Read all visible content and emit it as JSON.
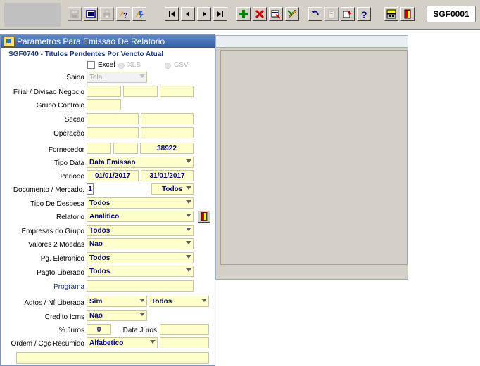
{
  "toolbar": {
    "screen_id": "SGF0001",
    "buttons": [
      {
        "name": "save-icon",
        "disabled": true
      },
      {
        "name": "clear-icon",
        "disabled": false
      },
      {
        "name": "print-icon",
        "disabled": true
      },
      {
        "name": "query-help-icon",
        "disabled": false
      },
      {
        "name": "execute-query-icon",
        "disabled": false
      },
      {
        "name": "first-record-icon",
        "disabled": false
      },
      {
        "name": "prev-record-icon",
        "disabled": false
      },
      {
        "name": "next-record-icon",
        "disabled": false
      },
      {
        "name": "last-record-icon",
        "disabled": false
      },
      {
        "name": "insert-record-icon",
        "disabled": false
      },
      {
        "name": "delete-record-icon",
        "disabled": false
      },
      {
        "name": "duplicate-record-icon",
        "disabled": false
      },
      {
        "name": "edit-icon",
        "disabled": false
      },
      {
        "name": "undo-icon",
        "disabled": false
      },
      {
        "name": "copy-icon",
        "disabled": true
      },
      {
        "name": "list-values-icon",
        "disabled": false
      },
      {
        "name": "help-icon",
        "disabled": false
      },
      {
        "name": "news-icon",
        "disabled": false
      },
      {
        "name": "exit-icon",
        "disabled": false
      }
    ]
  },
  "dialog": {
    "title": "Parametros Para Emissao De Relatorio",
    "subtitle": "SGF0740 - Titulos Pendentes Por Vencto Atual",
    "options": {
      "excel": "Excel",
      "xls": "XLS",
      "csv": "CSV"
    },
    "labels": {
      "saida": "Saida",
      "filial": "Filial / Divisao Negocio",
      "grupo": "Grupo Controle",
      "secao": "Secao",
      "operacao": "Operação",
      "fornecedor": "Fornecedor",
      "tipo_data": "Tipo Data",
      "periodo": "Periodo",
      "documento": "Documento / Mercado.",
      "tipo_despesa": "Tipo De Despesa",
      "relatorio": "Relatorio",
      "empresas": "Empresas do Grupo",
      "valores": "Valores 2 Moedas",
      "pg_eletronico": "Pg. Eletronico",
      "pagto": "Pagto Liberado",
      "programa": "Programa",
      "adtos": "Adtos / Nf Liberada",
      "credito": "Credito Icms",
      "juros": "% Juros",
      "data_juros": "Data Juros",
      "ordem": "Ordem / Cgc Resumido"
    },
    "values": {
      "saida": "Tela",
      "fornecedor": "38922",
      "tipo_data": "Data Emissao",
      "periodo_inicio": "01/01/2017",
      "periodo_fim": "31/01/2017",
      "documento": "1",
      "mercado": "Todos",
      "tipo_despesa": "Todos",
      "relatorio": "Analitico",
      "empresas": "Todos",
      "valores": "Nao",
      "pg_eletronico": "Todos",
      "pagto": "Todos",
      "adtos": "Sim",
      "nf_liberada": "Todos",
      "credito": "Nao",
      "juros": "0",
      "ordem": "Alfabetico"
    }
  }
}
